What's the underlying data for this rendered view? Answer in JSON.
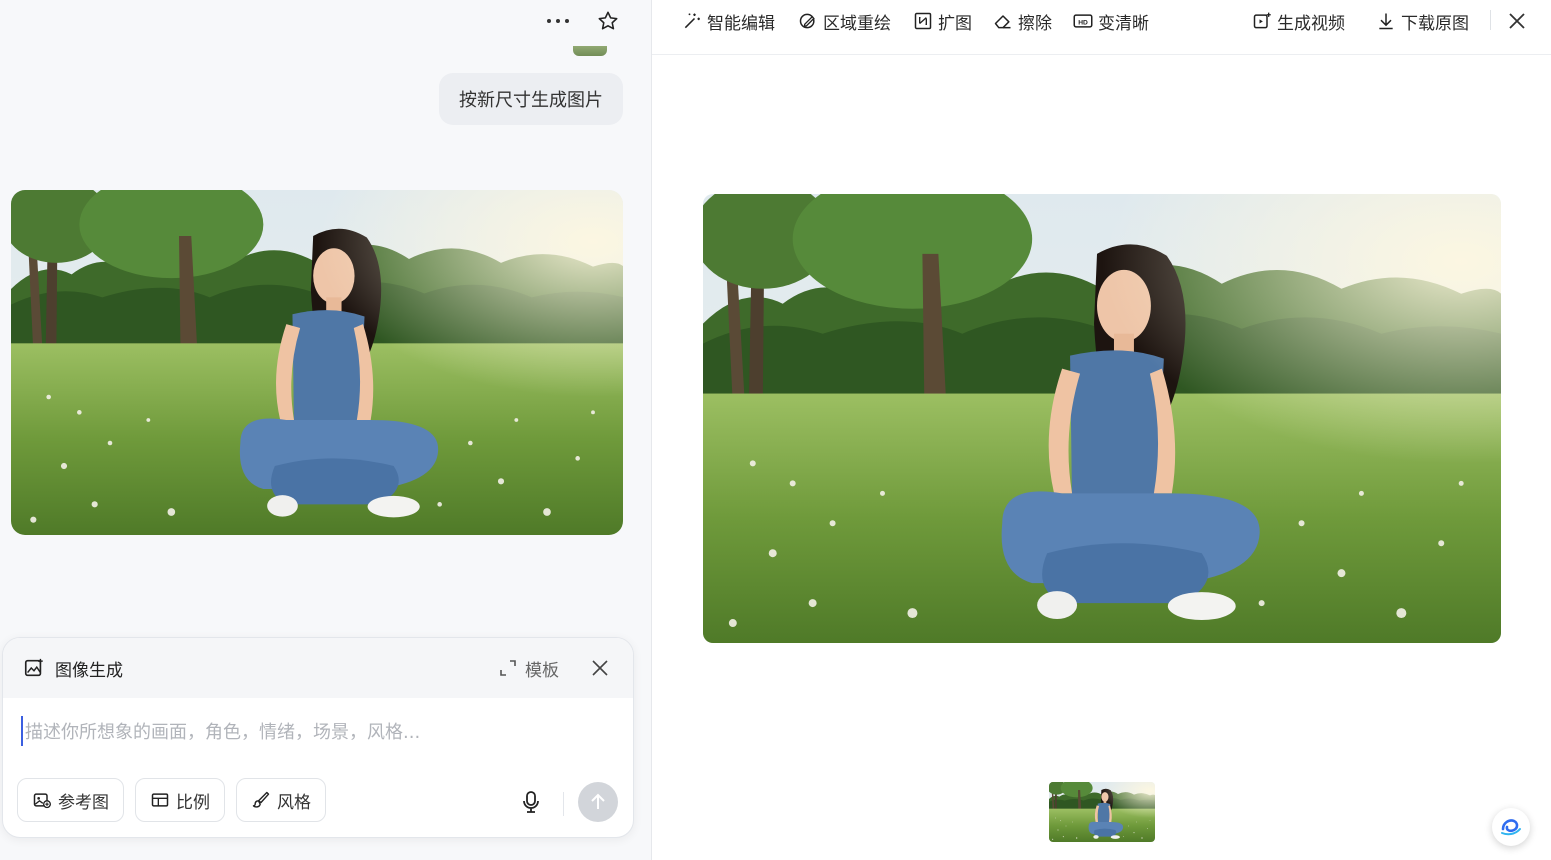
{
  "chat": {
    "user_message": "按新尺寸生成图片"
  },
  "composer": {
    "title": "图像生成",
    "template_label": "模板",
    "placeholder": "描述你所想象的画面，角色，情绪，场景，风格...",
    "chips": [
      {
        "label": "参考图",
        "icon": "reference-image-icon"
      },
      {
        "label": "比例",
        "icon": "aspect-ratio-icon"
      },
      {
        "label": "风格",
        "icon": "brush-icon"
      }
    ]
  },
  "toolbar": {
    "tools": [
      {
        "label": "智能编辑",
        "icon": "magic-wand-icon"
      },
      {
        "label": "区域重绘",
        "icon": "region-redraw-icon"
      },
      {
        "label": "扩图",
        "icon": "expand-image-icon"
      },
      {
        "label": "擦除",
        "icon": "eraser-icon"
      },
      {
        "label": "变清晰",
        "icon": "hd-icon"
      },
      {
        "label": "生成视频",
        "icon": "video-icon"
      },
      {
        "label": "下载原图",
        "icon": "download-icon"
      }
    ],
    "hd_badge": "HD"
  },
  "colors": {
    "accent": "#3b5fe0",
    "send_disabled": "#d2d5da",
    "panel_bg": "#f7f8fa"
  }
}
